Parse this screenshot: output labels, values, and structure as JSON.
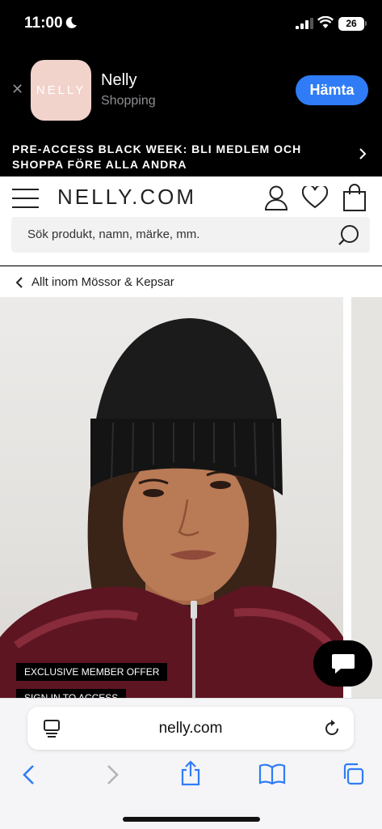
{
  "status_bar": {
    "time": "11:00",
    "battery": "26"
  },
  "app_banner": {
    "icon_text": "NELLY",
    "app_name": "Nelly",
    "app_category": "Shopping",
    "get_label": "Hämta"
  },
  "promo": {
    "text": "PRE-ACCESS BLACK WEEK: BLI MEDLEM OCH SHOPPA FÖRE ALLA ANDRA"
  },
  "header": {
    "logo": "NELLY.COM",
    "search_placeholder": "Sök produkt, namn, märke, mm."
  },
  "breadcrumb": {
    "label": "Allt inom Mössor & Kepsar"
  },
  "product": {
    "offer_badge": "EXCLUSIVE MEMBER OFFER",
    "signin_badge": "SIGN IN TO ACCESS"
  },
  "safari": {
    "url": "nelly.com"
  },
  "colors": {
    "accent": "#2f7cf6",
    "app_icon_bg": "#f1d3cc",
    "beanie": "#1b1b1b",
    "jacket": "#5d1522"
  }
}
